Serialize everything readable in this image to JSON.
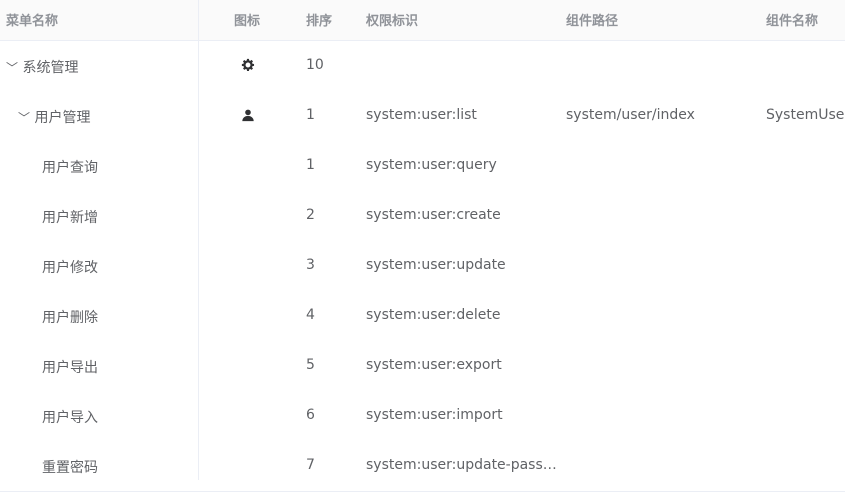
{
  "table": {
    "headers": {
      "name": "菜单名称",
      "icon": "图标",
      "sort": "排序",
      "perm": "权限标识",
      "path": "组件路径",
      "comp": "组件名称"
    },
    "rows": [
      {
        "name": "系统管理",
        "expand": "﹀",
        "icon": "gear-icon",
        "sort": "10",
        "perm": "",
        "path": "",
        "comp": ""
      },
      {
        "name": "用户管理",
        "expand": "﹀",
        "icon": "user-icon",
        "sort": "1",
        "perm": "system:user:list",
        "path": "system/user/index",
        "comp": "SystemUser"
      },
      {
        "name": "用户查询",
        "sort": "1",
        "perm": "system:user:query"
      },
      {
        "name": "用户新增",
        "sort": "2",
        "perm": "system:user:create"
      },
      {
        "name": "用户修改",
        "sort": "3",
        "perm": "system:user:update"
      },
      {
        "name": "用户删除",
        "sort": "4",
        "perm": "system:user:delete"
      },
      {
        "name": "用户导出",
        "sort": "5",
        "perm": "system:user:export"
      },
      {
        "name": "用户导入",
        "sort": "6",
        "perm": "system:user:import"
      },
      {
        "name": "重置密码",
        "sort": "7",
        "perm": "system:user:update-pass…"
      }
    ]
  }
}
